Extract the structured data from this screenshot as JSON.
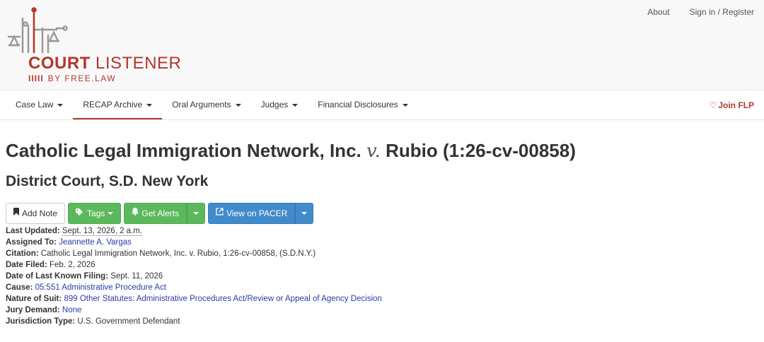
{
  "header": {
    "brand": {
      "court": "COURT",
      "listener": "LISTENER",
      "byline": "BY FREE.LAW",
      "byline_bars": "IIIII"
    },
    "links": {
      "about": "About",
      "signin": "Sign in / Register"
    }
  },
  "nav": {
    "items": [
      {
        "label": "Case Law"
      },
      {
        "label": "RECAP Archive"
      },
      {
        "label": "Oral Arguments"
      },
      {
        "label": "Judges"
      },
      {
        "label": "Financial Disclosures"
      }
    ],
    "join": "Join FLP"
  },
  "case": {
    "title_left": "Catholic Legal Immigration Network, Inc.",
    "title_v": "v.",
    "title_right": "Rubio (1:26-cv-00858)",
    "court": "District Court, S.D. New York"
  },
  "buttons": {
    "add_note": "Add Note",
    "tags": "Tags",
    "get_alerts": "Get Alerts",
    "view_pacer": "View on PACER"
  },
  "details": {
    "last_updated_label": "Last Updated:",
    "last_updated_value": "Sept. 13, 2026, 2 a.m.",
    "assigned_label": "Assigned To:",
    "assigned_value": "Jeannette A. Vargas",
    "citation_label": "Citation:",
    "citation_value": "Catholic Legal Immigration Network, Inc. v. Rubio, 1:26-cv-00858, (S.D.N.Y.)",
    "filed_label": "Date Filed:",
    "filed_value": "Feb. 2, 2026",
    "last_filing_label": "Date of Last Known Filing:",
    "last_filing_value": "Sept. 11, 2026",
    "cause_label": "Cause:",
    "cause_value": "05:551 Administrative Procedure Act",
    "nature_label": "Nature of Suit:",
    "nature_value": "899 Other Statutes: Administrative Procedures Act/Review or Appeal of Agency Decision",
    "jury_label": "Jury Demand:",
    "jury_value": "None",
    "jurisdiction_label": "Jurisdiction Type:",
    "jurisdiction_value": "U.S. Government Defendant"
  },
  "colors": {
    "brand": "#b5362a",
    "success": "#5cb85c",
    "primary": "#428bca",
    "link": "#2a3ca7"
  },
  "icons": [
    "logo-scales-icon",
    "bookmark-icon",
    "tags-icon",
    "bell-icon",
    "external-link-icon",
    "heart-icon",
    "caret-down-icon"
  ]
}
